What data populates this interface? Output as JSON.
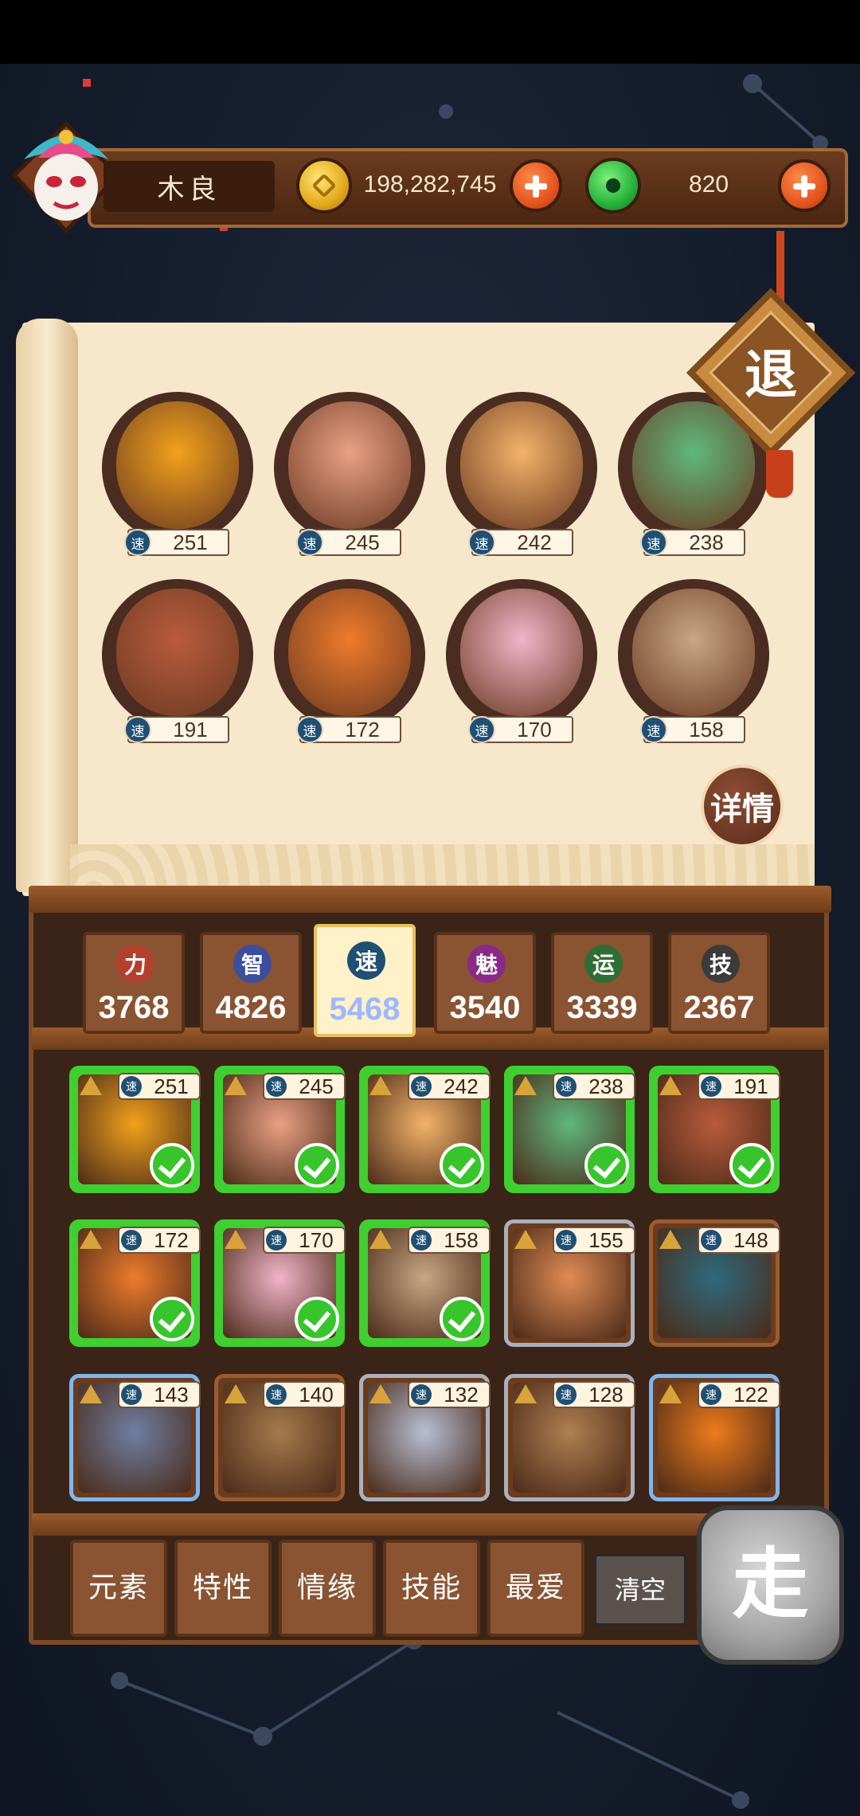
{
  "player": {
    "name": "木良",
    "gold": "198,282,745",
    "jade": "820"
  },
  "exit_label": "退",
  "detail_label": "详情",
  "speed_label": "速",
  "lineup": [
    {
      "speed": "251",
      "color": "#f2a21b"
    },
    {
      "speed": "245",
      "color": "#e9a184"
    },
    {
      "speed": "242",
      "color": "#f3b36a"
    },
    {
      "speed": "238",
      "color": "#5fb87d"
    },
    {
      "speed": "191",
      "color": "#b95b3c"
    },
    {
      "speed": "172",
      "color": "#ee7b2c"
    },
    {
      "speed": "170",
      "color": "#f2b4c8"
    },
    {
      "speed": "158",
      "color": "#c7a784"
    }
  ],
  "stats": [
    {
      "icon": "力",
      "value": "3768",
      "icon_color": "#b3402c"
    },
    {
      "icon": "智",
      "value": "4826",
      "icon_color": "#3d4f9c"
    },
    {
      "icon": "速",
      "value": "5468",
      "icon_color": "#1f4f73"
    },
    {
      "icon": "魅",
      "value": "3540",
      "icon_color": "#8a2a86"
    },
    {
      "icon": "运",
      "value": "3339",
      "icon_color": "#2f6e33"
    },
    {
      "icon": "技",
      "value": "2367",
      "icon_color": "#3b3b3b"
    }
  ],
  "roster": [
    {
      "speed": "251",
      "selected": true,
      "frame": "green",
      "color": "#f2a21b"
    },
    {
      "speed": "245",
      "selected": true,
      "frame": "green",
      "color": "#e9a184"
    },
    {
      "speed": "242",
      "selected": true,
      "frame": "green",
      "color": "#f3b36a"
    },
    {
      "speed": "238",
      "selected": true,
      "frame": "green",
      "color": "#5fb87d"
    },
    {
      "speed": "191",
      "selected": true,
      "frame": "green",
      "color": "#b95b3c"
    },
    {
      "speed": "172",
      "selected": true,
      "frame": "green",
      "color": "#ee7b2c"
    },
    {
      "speed": "170",
      "selected": true,
      "frame": "green",
      "color": "#f2b4c8"
    },
    {
      "speed": "158",
      "selected": true,
      "frame": "green",
      "color": "#c7a784"
    },
    {
      "speed": "155",
      "selected": false,
      "frame": "grey",
      "color": "#e08c55"
    },
    {
      "speed": "148",
      "selected": false,
      "frame": "brown",
      "color": "#2e6a7d"
    },
    {
      "speed": "143",
      "selected": false,
      "frame": "blue",
      "color": "#6f7fa2"
    },
    {
      "speed": "140",
      "selected": false,
      "frame": "brown",
      "color": "#a57a4c"
    },
    {
      "speed": "132",
      "selected": false,
      "frame": "grey",
      "color": "#b7bfd4"
    },
    {
      "speed": "128",
      "selected": false,
      "frame": "grey",
      "color": "#b07f52"
    },
    {
      "speed": "122",
      "selected": false,
      "frame": "blue",
      "color": "#ee7b1b"
    }
  ],
  "filters": [
    "元素",
    "特性",
    "情缘",
    "技能",
    "最爱"
  ],
  "clear_label": "清空",
  "go_label": "走"
}
